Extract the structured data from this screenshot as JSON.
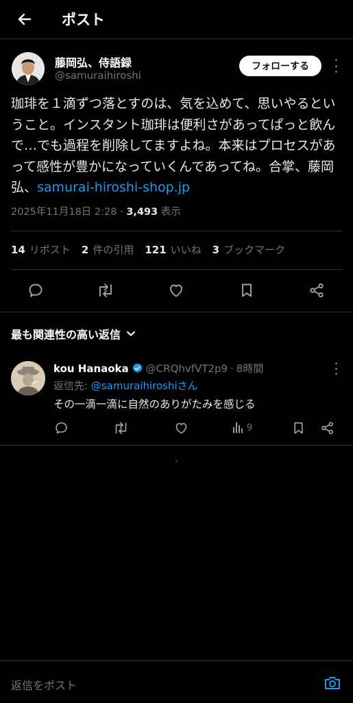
{
  "header": {
    "title": "ポスト"
  },
  "post": {
    "author_name": "藤岡弘、侍語録",
    "author_handle": "@samuraihiroshi",
    "follow_label": "フォローする",
    "text_main": "珈琲を１滴ずつ落とすのは、気を込めて、思いやるということ。インスタント珈琲は便利さがあってぱっと飲んで…でも過程を削除してますよね。本来はプロセスがあって感性が豊かになっていくんであってね。合掌、藤岡弘、",
    "text_link": "samurai-hiroshi-shop.jp",
    "timestamp": "2025年11月18日 2:28",
    "view_count": "3,493",
    "view_label": "表示"
  },
  "stats": {
    "reposts_count": "14",
    "reposts_label": "リポスト",
    "quotes_count": "2",
    "quotes_label": "件の引用",
    "likes_count": "121",
    "likes_label": "いいね",
    "bookmarks_count": "3",
    "bookmarks_label": "ブックマーク"
  },
  "sort_label": "最も関連性の高い返信",
  "reply": {
    "name": "kou Hanaoka",
    "handle": "@CRQhvfVT2p9",
    "time": "8時間",
    "reply_to_prefix": "返信先: ",
    "reply_to_handle": "@samuraihiroshiさん",
    "text": "その一滴一滴に自然のありがたみを感じる",
    "view_count": "9"
  },
  "composer": {
    "placeholder": "返信をポスト"
  },
  "colors": {
    "accent": "#1d9bf0",
    "background": "#000000",
    "muted": "#71767b",
    "divider": "#2f3336"
  },
  "icons": [
    "back-arrow-icon",
    "more-icon",
    "reply-icon",
    "repost-icon",
    "like-icon",
    "bookmark-icon",
    "share-icon",
    "chevron-down-icon",
    "verified-icon",
    "views-icon",
    "camera-icon"
  ]
}
